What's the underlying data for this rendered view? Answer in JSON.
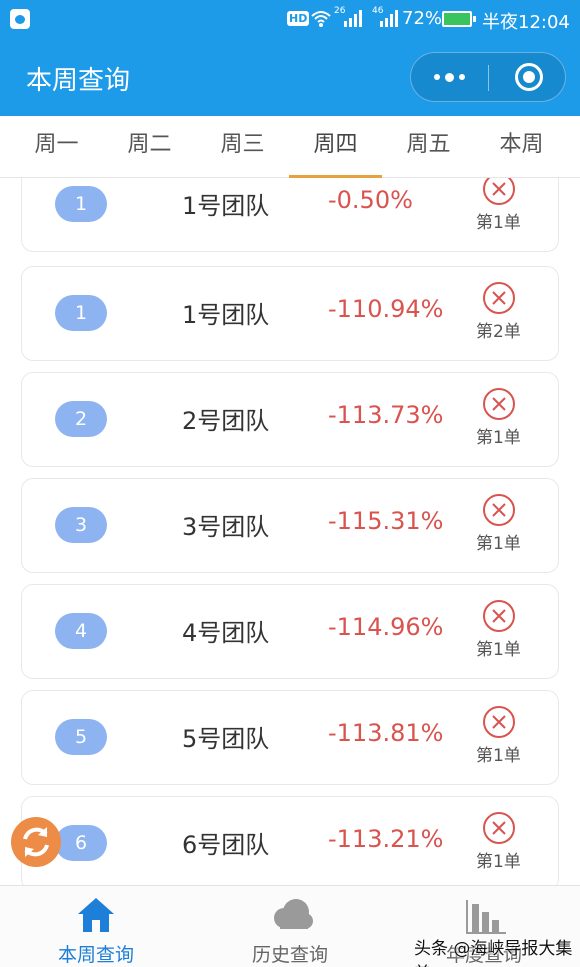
{
  "status_bar": {
    "hd": "HD",
    "net1": "26",
    "net2": "46",
    "battery_percent": "72%",
    "time": "半夜12:04"
  },
  "header": {
    "title": "本周查询"
  },
  "tabs": [
    {
      "label": "周一",
      "active": false
    },
    {
      "label": "周二",
      "active": false
    },
    {
      "label": "周三",
      "active": false
    },
    {
      "label": "周四",
      "active": true
    },
    {
      "label": "周五",
      "active": false
    },
    {
      "label": "本周",
      "active": false
    }
  ],
  "rows": [
    {
      "rank": "1",
      "team": "1号团队",
      "percent": "-0.50%",
      "order": "第1单"
    },
    {
      "rank": "1",
      "team": "1号团队",
      "percent": "-110.94%",
      "order": "第2单"
    },
    {
      "rank": "2",
      "team": "2号团队",
      "percent": "-113.73%",
      "order": "第1单"
    },
    {
      "rank": "3",
      "team": "3号团队",
      "percent": "-115.31%",
      "order": "第1单"
    },
    {
      "rank": "4",
      "team": "4号团队",
      "percent": "-114.96%",
      "order": "第1单"
    },
    {
      "rank": "5",
      "team": "5号团队",
      "percent": "-113.81%",
      "order": "第1单"
    },
    {
      "rank": "6",
      "team": "6号团队",
      "percent": "-113.21%",
      "order": "第1单"
    }
  ],
  "bottom_nav": [
    {
      "label": "本周查询",
      "icon": "home-icon",
      "active": true
    },
    {
      "label": "历史查询",
      "icon": "cloud-icon",
      "active": false
    },
    {
      "label": "年度查询",
      "icon": "bar-chart-icon",
      "active": false
    }
  ],
  "watermark": "头条 @海峡导报大集美",
  "colors": {
    "primary": "#1e9be8",
    "tab_underline": "#e6a23c",
    "pill": "#8db4f0",
    "negative": "#d9534f",
    "refresh": "#ec8c47"
  }
}
